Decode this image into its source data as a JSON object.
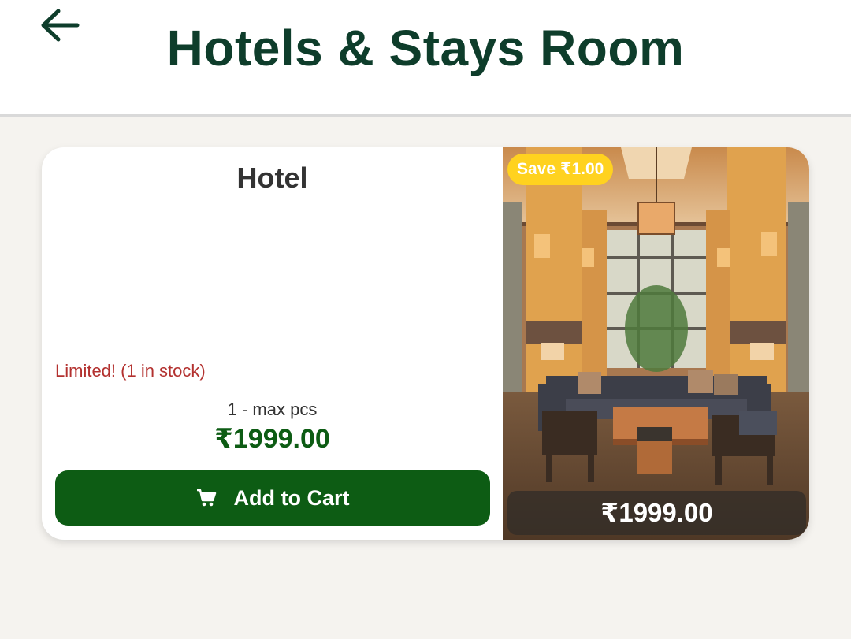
{
  "header": {
    "title": "Hotels & Stays Room",
    "back_icon": "arrow-left-icon"
  },
  "product": {
    "name": "Hotel",
    "stock_status": "Limited! (1 in stock)",
    "quantity_limit": "1 - max pcs",
    "price": "₹1999.00",
    "add_to_cart_label": "Add to Cart",
    "cart_icon": "cart-icon",
    "save_badge": "Save ₹1.00",
    "image_price": "₹1999.00",
    "image_alt": "hotel lobby lounge with sofas and pillars"
  },
  "colors": {
    "brand_green": "#0d5c14",
    "title_green": "#0e3d2b",
    "stock_red": "#b3312f",
    "badge_yellow": "#ffd21f",
    "background": "#f5f3ef"
  }
}
